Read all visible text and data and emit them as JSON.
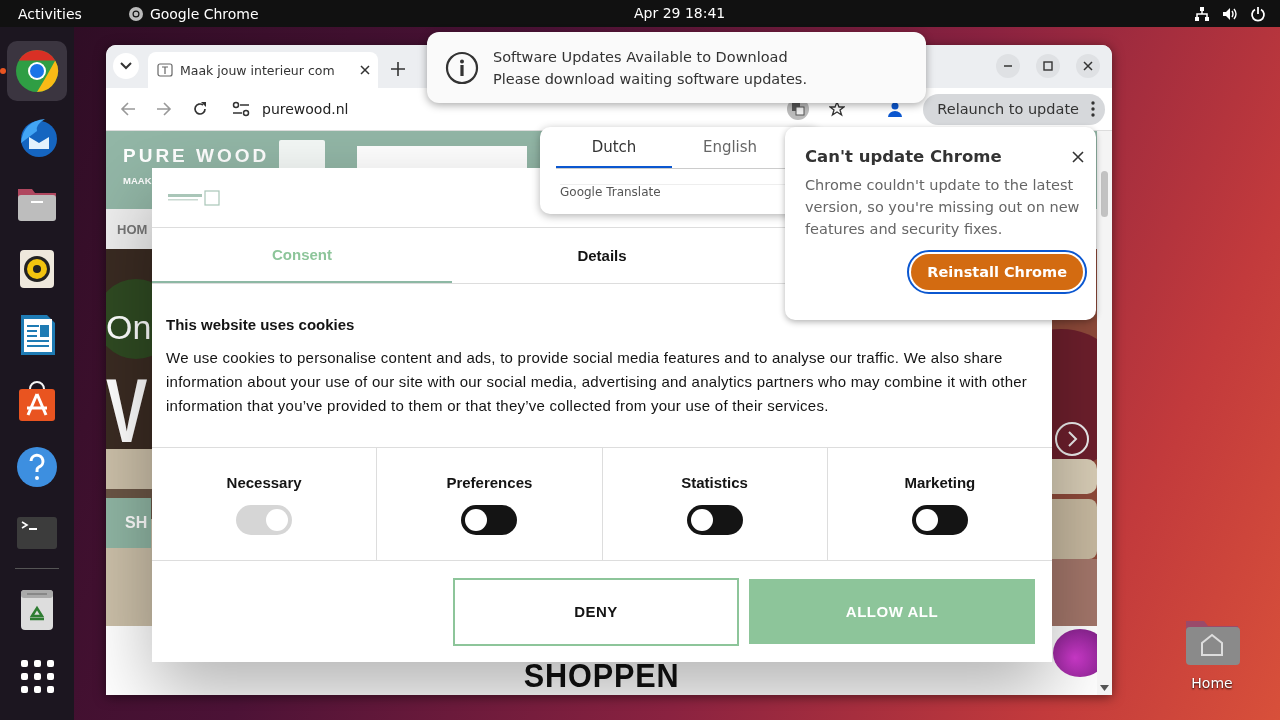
{
  "top_bar": {
    "activities": "Activities",
    "app": "Google Chrome",
    "clock": "Apr 29  18:41"
  },
  "dock_items": [
    {
      "kind": "browser",
      "running": true
    },
    {
      "kind": "mail",
      "running": false
    },
    {
      "kind": "folder",
      "running": false
    },
    {
      "kind": "speaker",
      "running": false
    },
    {
      "kind": "document",
      "running": false
    },
    {
      "kind": "store",
      "running": false
    },
    {
      "kind": "help",
      "running": false
    },
    {
      "kind": "terminal",
      "running": false
    },
    {
      "kind": "trash",
      "running": false
    },
    {
      "kind": "apps",
      "running": false
    }
  ],
  "notification": {
    "title": "Software Updates Available to Download",
    "body": "Please download waiting software updates."
  },
  "browser": {
    "tabs": [
      {
        "title": "Maak jouw interieur com",
        "selected": true
      }
    ],
    "address": "purewood.nl",
    "relaunch": "Relaunch to update"
  },
  "page": {
    "logo": "PURE WOOD",
    "tagline": "MAAK",
    "nav": "HOM",
    "hero_title": "On",
    "hero_letter": "V",
    "hero_button": "SH",
    "section_heading": "SHOPPEN"
  },
  "cookie_dialog": {
    "tabs": [
      {
        "label": "Consent",
        "selected": true
      },
      {
        "label": "Details",
        "selected": false
      }
    ],
    "heading": "This website uses cookies",
    "text": "We use cookies to personalise content and ads, to provide social media features and to analyse our traffic. We also share information about your use of our site with our social media, advertising and analytics partners who may combine it with other information that you’ve provided to them or that they’ve collected from your use of their services.",
    "categories": [
      {
        "label": "Necessary",
        "checked": true,
        "disabled": true
      },
      {
        "label": "Preferences",
        "checked": false,
        "disabled": false
      },
      {
        "label": "Statistics",
        "checked": false,
        "disabled": false
      },
      {
        "label": "Marketing",
        "checked": false,
        "disabled": false
      }
    ],
    "buttons": [
      {
        "label": "DENY",
        "kind": "outline"
      },
      {
        "label": "ALLOW ALL",
        "kind": "filled"
      }
    ]
  },
  "translate_popup": {
    "tabs": [
      {
        "label": "Dutch",
        "selected": true
      },
      {
        "label": "English",
        "selected": false
      }
    ],
    "provider": "Google Translate"
  },
  "update_popup": {
    "title": "Can't update Chrome",
    "body": "Chrome couldn't update to the latest version, so you're missing out on new features and security fixes.",
    "button": "Reinstall Chrome"
  },
  "desktop_icons": [
    {
      "label": "Home"
    }
  ]
}
